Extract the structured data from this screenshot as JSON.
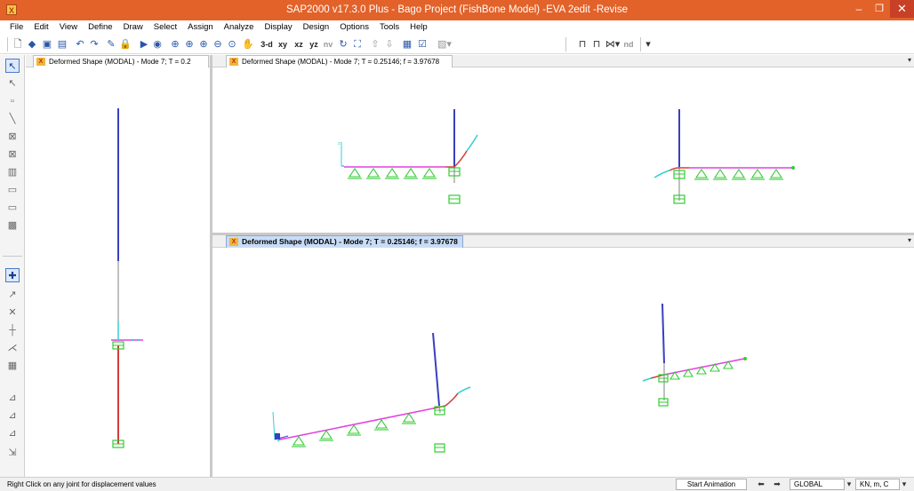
{
  "window": {
    "title": "SAP2000 v17.3.0 Plus  - Bago Project (FishBone Model) -EVA 2edit -Revise",
    "app_icon": "sap2000-icon"
  },
  "menu": [
    "File",
    "Edit",
    "View",
    "Define",
    "Draw",
    "Select",
    "Assign",
    "Analyze",
    "Display",
    "Design",
    "Options",
    "Tools",
    "Help"
  ],
  "toolbar": {
    "view_3d": "3-d",
    "view_xy": "xy",
    "view_xz": "xz",
    "view_yz": "yz",
    "view_nv": "nv",
    "nd": "nd"
  },
  "panels": {
    "left": {
      "tab": "Deformed Shape (MODAL) - Mode 7; T = 0.2"
    },
    "top": {
      "tab": "Deformed Shape (MODAL) - Mode 7; T = 0.25146;  f = 3.97678"
    },
    "bottom": {
      "tab": "Deformed Shape (MODAL) - Mode 7; T = 0.25146;  f = 3.97678"
    }
  },
  "status": {
    "message": "Right Click on any joint for displacement values",
    "animation_button": "Start Animation",
    "coord_system": "GLOBAL",
    "units": "KN, m, C"
  },
  "colors": {
    "titlebar": "#e2622a",
    "column_upper": "#3a3fc0",
    "column_lower": "#d23c3c",
    "beam_deformed": "#e040e0",
    "supports": "#33cc33",
    "joints": "#33d0d0"
  }
}
